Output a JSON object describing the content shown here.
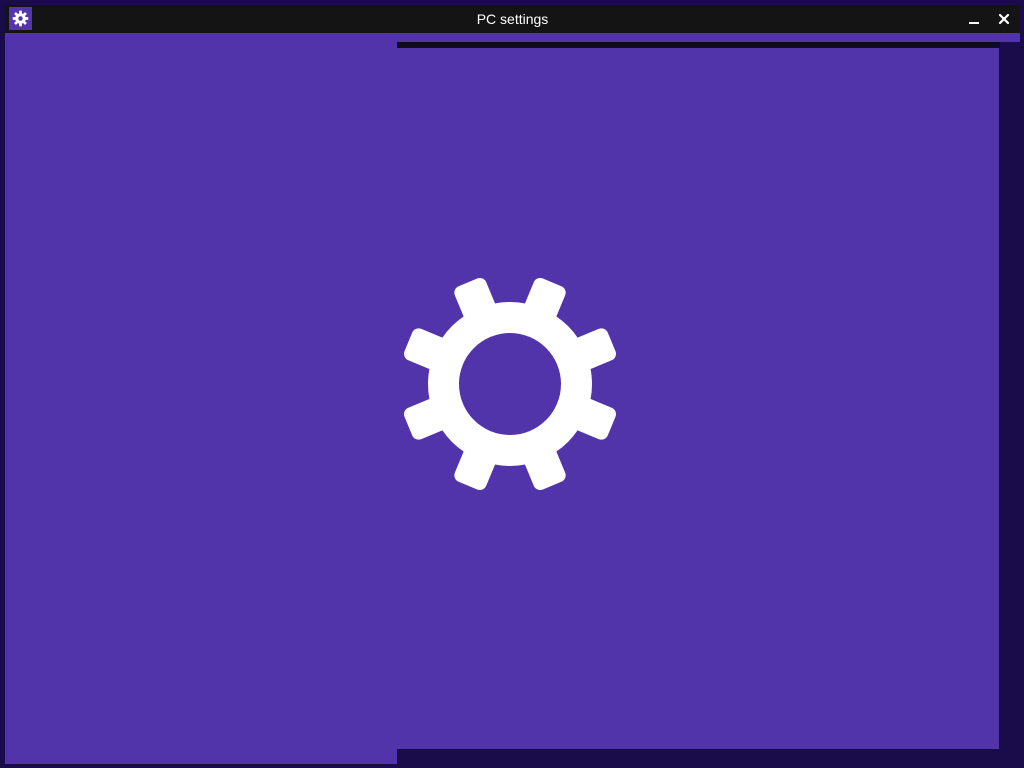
{
  "window": {
    "title": "PC settings",
    "app_icon": "gear-icon",
    "controls": {
      "minimize_icon": "minimize-icon",
      "close_icon": "close-icon"
    }
  },
  "splash": {
    "icon": "gear-icon"
  },
  "colors": {
    "accent": "#5234aa",
    "titlebar": "#141414",
    "frame": "#1a0b4a",
    "icon": "#ffffff"
  }
}
